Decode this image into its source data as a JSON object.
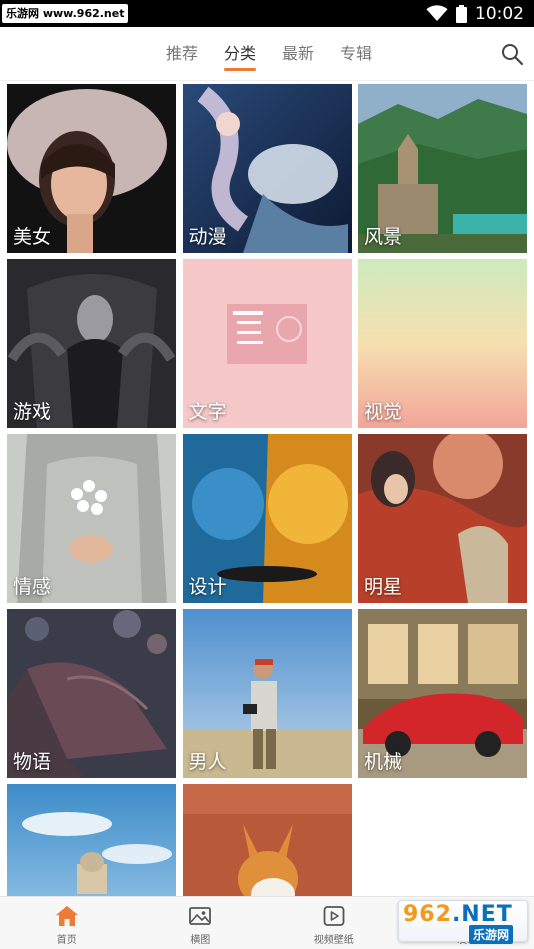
{
  "status_bar": {
    "badge": "乐游网 www.962.net",
    "time": "10:02"
  },
  "tabs": [
    {
      "label": "推荐",
      "active": false
    },
    {
      "label": "分类",
      "active": true
    },
    {
      "label": "最新",
      "active": false
    },
    {
      "label": "专辑",
      "active": false
    }
  ],
  "search_icon": "search-icon",
  "categories": [
    {
      "label": "美女",
      "icon": "portrait-photo"
    },
    {
      "label": "动漫",
      "icon": "anime-mermaid"
    },
    {
      "label": "风景",
      "icon": "mountain-church"
    },
    {
      "label": "游戏",
      "icon": "game-character"
    },
    {
      "label": "文字",
      "icon": "pink-note"
    },
    {
      "label": "视觉",
      "icon": "gradient"
    },
    {
      "label": "情感",
      "icon": "flower-bouquet"
    },
    {
      "label": "设计",
      "icon": "lion-art"
    },
    {
      "label": "明星",
      "icon": "costume-drama"
    },
    {
      "label": "物语",
      "icon": "open-book"
    },
    {
      "label": "男人",
      "icon": "man-photographer"
    },
    {
      "label": "机械",
      "icon": "red-sportscar"
    },
    {
      "label": "",
      "icon": "city-sky"
    },
    {
      "label": "",
      "icon": "corgi-dog"
    }
  ],
  "bottom_nav": [
    {
      "label": "首页",
      "icon": "home-icon",
      "active": true
    },
    {
      "label": "横图",
      "icon": "image-icon",
      "active": false
    },
    {
      "label": "视频壁纸",
      "icon": "play-icon",
      "active": false
    },
    {
      "label": "发现",
      "icon": "search-icon",
      "active": false
    }
  ],
  "watermark": {
    "digits": "962",
    "net": ".NET",
    "sub": "乐游网"
  },
  "colors": {
    "accent": "#ef7a35",
    "tab_inactive": "#777777",
    "tab_active": "#333333"
  }
}
